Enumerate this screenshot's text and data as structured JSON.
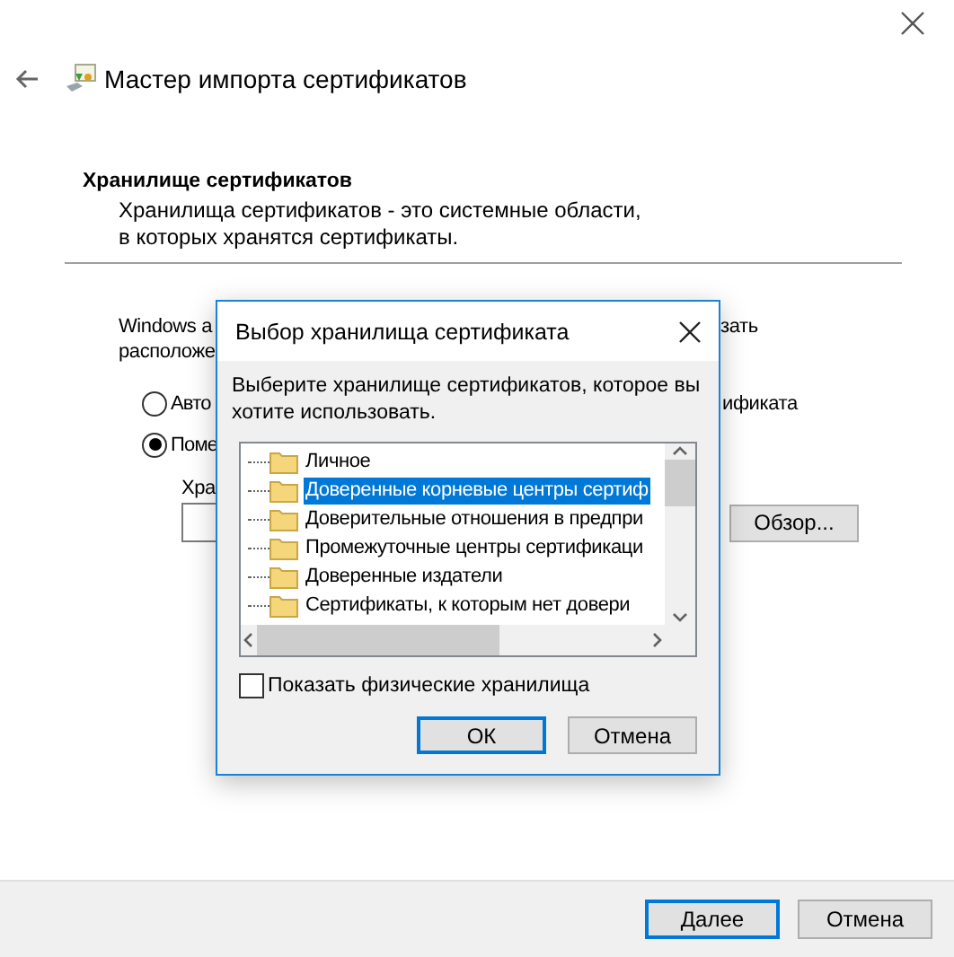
{
  "window": {
    "title": "Мастер импорта сертификатов"
  },
  "section": {
    "title": "Хранилище сертификатов",
    "description": "Хранилища сертификатов - это системные области, в которых хранятся сертификаты."
  },
  "background": {
    "intro_left": "Windows a",
    "intro_right": "зать",
    "intro_line2": "расположе",
    "options": [
      {
        "label": "Авто",
        "label_right": "ификата",
        "selected": false
      },
      {
        "label": "Поме",
        "selected": true
      }
    ],
    "store_label": "Хра",
    "browse_button": "Обзор..."
  },
  "dialog": {
    "title": "Выбор хранилища сертификата",
    "prompt": "Выберите хранилище сертификатов, которое вы хотите использовать.",
    "stores": [
      {
        "label": "Личное",
        "selected": false
      },
      {
        "label": "Доверенные корневые центры сертиф",
        "selected": true
      },
      {
        "label": "Доверительные отношения в предпри",
        "selected": false
      },
      {
        "label": "Промежуточные центры сертификаци",
        "selected": false
      },
      {
        "label": "Доверенные издатели",
        "selected": false
      },
      {
        "label": "Сертификаты, к которым нет довери",
        "selected": false
      }
    ],
    "show_physical": {
      "label": "Показать физические хранилища",
      "checked": false
    },
    "buttons": [
      {
        "label": "ОК",
        "default": true
      },
      {
        "label": "Отмена",
        "default": false
      }
    ]
  },
  "footer": {
    "buttons": [
      {
        "label": "Далее",
        "default": true
      },
      {
        "label": "Отмена",
        "default": false
      }
    ]
  }
}
